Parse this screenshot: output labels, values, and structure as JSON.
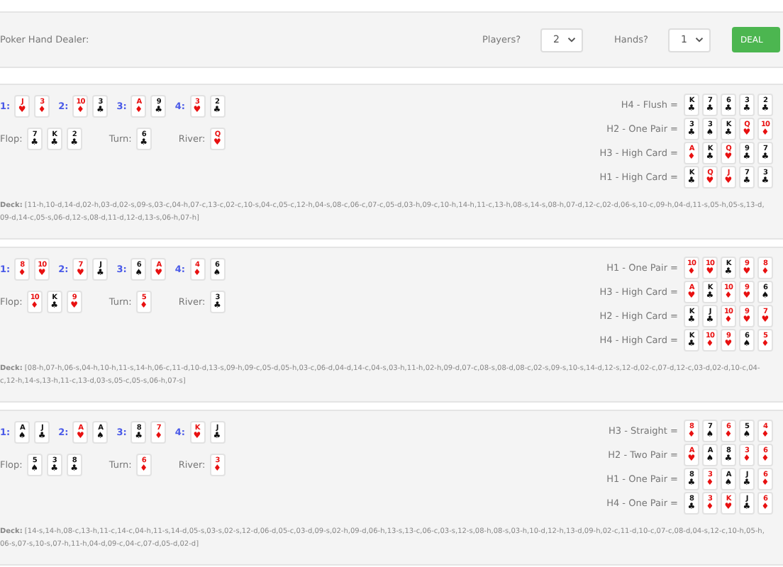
{
  "header": {
    "title": "Poker Hand Dealer:",
    "players_label": "Players?",
    "players_value": "2",
    "hands_label": "Hands?",
    "hands_value": "1",
    "deal_button": "DEAL"
  },
  "games": [
    {
      "players": [
        {
          "label": "1:",
          "cards": [
            {
              "rank": "J",
              "suit": "♥",
              "red": true
            },
            {
              "rank": "3",
              "suit": "♦",
              "red": true
            }
          ]
        },
        {
          "label": "2:",
          "cards": [
            {
              "rank": "10",
              "suit": "♦",
              "red": true
            },
            {
              "rank": "3",
              "suit": "♣",
              "red": false
            }
          ]
        },
        {
          "label": "3:",
          "cards": [
            {
              "rank": "A",
              "suit": "♦",
              "red": true
            },
            {
              "rank": "9",
              "suit": "♣",
              "red": false
            }
          ]
        },
        {
          "label": "4:",
          "cards": [
            {
              "rank": "3",
              "suit": "♥",
              "red": true
            },
            {
              "rank": "2",
              "suit": "♣",
              "red": false
            }
          ]
        }
      ],
      "flop_label": "Flop:",
      "flop": [
        {
          "rank": "7",
          "suit": "♣",
          "red": false
        },
        {
          "rank": "K",
          "suit": "♣",
          "red": false
        },
        {
          "rank": "2",
          "suit": "♣",
          "red": false
        }
      ],
      "turn_label": "Turn:",
      "turn": {
        "rank": "6",
        "suit": "♣",
        "red": false
      },
      "river_label": "River:",
      "river": {
        "rank": "Q",
        "suit": "♥",
        "red": true
      },
      "deck_text": "**Deck:** [11-h,10-d,14-d,02-h,03-d,02-s,09-s,03-c,04-h,07-c,13-c,02-c,10-s,04-c,05-c,12-h,04-s,08-c,06-c,07-c,05-d,03-h,09-c,10-h,14-h,11-c,13-h,08-s,14-s,08-h,07-d,12-c,02-d,06-s,10-c,09-h,04-d,11-s,05-h,05-s,13-d,09-d,14-c,05-s,06-d,12-s,08-d,11-d,12-d,13-s,06-h,07-h]",
      "results": [
        {
          "label": "H4 - Flush =",
          "cards": [
            {
              "rank": "K",
              "suit": "♣",
              "red": false
            },
            {
              "rank": "7",
              "suit": "♣",
              "red": false
            },
            {
              "rank": "6",
              "suit": "♣",
              "red": false
            },
            {
              "rank": "3",
              "suit": "♣",
              "red": false
            },
            {
              "rank": "2",
              "suit": "♣",
              "red": false
            }
          ]
        },
        {
          "label": "H2 - One Pair =",
          "cards": [
            {
              "rank": "3",
              "suit": "♣",
              "red": false
            },
            {
              "rank": "3",
              "suit": "♠",
              "red": false
            },
            {
              "rank": "K",
              "suit": "♣",
              "red": false
            },
            {
              "rank": "Q",
              "suit": "♥",
              "red": true
            },
            {
              "rank": "10",
              "suit": "♦",
              "red": true
            }
          ]
        },
        {
          "label": "H3 - High Card =",
          "cards": [
            {
              "rank": "A",
              "suit": "♦",
              "red": true
            },
            {
              "rank": "K",
              "suit": "♣",
              "red": false
            },
            {
              "rank": "Q",
              "suit": "♥",
              "red": true
            },
            {
              "rank": "9",
              "suit": "♣",
              "red": false
            },
            {
              "rank": "7",
              "suit": "♣",
              "red": false
            }
          ]
        },
        {
          "label": "H1 - High Card =",
          "cards": [
            {
              "rank": "K",
              "suit": "♣",
              "red": false
            },
            {
              "rank": "Q",
              "suit": "♥",
              "red": true
            },
            {
              "rank": "J",
              "suit": "♥",
              "red": true
            },
            {
              "rank": "7",
              "suit": "♣",
              "red": false
            },
            {
              "rank": "3",
              "suit": "♣",
              "red": false
            }
          ]
        }
      ]
    },
    {
      "players": [
        {
          "label": "1:",
          "cards": [
            {
              "rank": "8",
              "suit": "♦",
              "red": true
            },
            {
              "rank": "10",
              "suit": "♥",
              "red": true
            }
          ]
        },
        {
          "label": "2:",
          "cards": [
            {
              "rank": "7",
              "suit": "♥",
              "red": true
            },
            {
              "rank": "J",
              "suit": "♣",
              "red": false
            }
          ]
        },
        {
          "label": "3:",
          "cards": [
            {
              "rank": "6",
              "suit": "♠",
              "red": false
            },
            {
              "rank": "A",
              "suit": "♥",
              "red": true
            }
          ]
        },
        {
          "label": "4:",
          "cards": [
            {
              "rank": "4",
              "suit": "♦",
              "red": true
            },
            {
              "rank": "6",
              "suit": "♠",
              "red": false
            }
          ]
        }
      ],
      "flop_label": "Flop:",
      "flop": [
        {
          "rank": "10",
          "suit": "♦",
          "red": true
        },
        {
          "rank": "K",
          "suit": "♣",
          "red": false
        },
        {
          "rank": "9",
          "suit": "♥",
          "red": true
        }
      ],
      "turn_label": "Turn:",
      "turn": {
        "rank": "5",
        "suit": "♦",
        "red": true
      },
      "river_label": "River:",
      "river": {
        "rank": "3",
        "suit": "♣",
        "red": false
      },
      "deck_text": "**Deck:** [08-h,07-h,06-s,04-h,10-h,11-s,14-h,06-c,11-d,10-d,13-s,09-h,09-c,05-d,05-h,03-c,06-d,04-d,14-c,04-s,03-h,11-h,02-h,09-d,07-c,08-s,08-d,08-c,02-s,09-s,10-s,14-d,12-s,12-d,02-c,07-d,12-c,03-d,02-d,10-c,04-c,12-h,14-s,13-h,11-c,13-d,03-s,05-c,05-s,06-h,07-s]",
      "results": [
        {
          "label": "H1 - One Pair =",
          "cards": [
            {
              "rank": "10",
              "suit": "♦",
              "red": true
            },
            {
              "rank": "10",
              "suit": "♥",
              "red": true
            },
            {
              "rank": "K",
              "suit": "♣",
              "red": false
            },
            {
              "rank": "9",
              "suit": "♥",
              "red": true
            },
            {
              "rank": "8",
              "suit": "♦",
              "red": true
            }
          ]
        },
        {
          "label": "H3 - High Card =",
          "cards": [
            {
              "rank": "A",
              "suit": "♥",
              "red": true
            },
            {
              "rank": "K",
              "suit": "♣",
              "red": false
            },
            {
              "rank": "10",
              "suit": "♦",
              "red": true
            },
            {
              "rank": "9",
              "suit": "♥",
              "red": true
            },
            {
              "rank": "6",
              "suit": "♠",
              "red": false
            }
          ]
        },
        {
          "label": "H2 - High Card =",
          "cards": [
            {
              "rank": "K",
              "suit": "♣",
              "red": false
            },
            {
              "rank": "J",
              "suit": "♣",
              "red": false
            },
            {
              "rank": "10",
              "suit": "♦",
              "red": true
            },
            {
              "rank": "9",
              "suit": "♥",
              "red": true
            },
            {
              "rank": "7",
              "suit": "♥",
              "red": true
            }
          ]
        },
        {
          "label": "H4 - High Card =",
          "cards": [
            {
              "rank": "K",
              "suit": "♣",
              "red": false
            },
            {
              "rank": "10",
              "suit": "♦",
              "red": true
            },
            {
              "rank": "9",
              "suit": "♥",
              "red": true
            },
            {
              "rank": "6",
              "suit": "♠",
              "red": false
            },
            {
              "rank": "5",
              "suit": "♦",
              "red": true
            }
          ]
        }
      ]
    },
    {
      "players": [
        {
          "label": "1:",
          "cards": [
            {
              "rank": "A",
              "suit": "♠",
              "red": false
            },
            {
              "rank": "J",
              "suit": "♣",
              "red": false
            }
          ]
        },
        {
          "label": "2:",
          "cards": [
            {
              "rank": "A",
              "suit": "♥",
              "red": true
            },
            {
              "rank": "A",
              "suit": "♠",
              "red": false
            }
          ]
        },
        {
          "label": "3:",
          "cards": [
            {
              "rank": "8",
              "suit": "♣",
              "red": false
            },
            {
              "rank": "7",
              "suit": "♦",
              "red": true
            }
          ]
        },
        {
          "label": "4:",
          "cards": [
            {
              "rank": "K",
              "suit": "♥",
              "red": true
            },
            {
              "rank": "J",
              "suit": "♣",
              "red": false
            }
          ]
        }
      ],
      "flop_label": "Flop:",
      "flop": [
        {
          "rank": "5",
          "suit": "♠",
          "red": false
        },
        {
          "rank": "3",
          "suit": "♣",
          "red": false
        },
        {
          "rank": "8",
          "suit": "♣",
          "red": false
        }
      ],
      "turn_label": "Turn:",
      "turn": {
        "rank": "6",
        "suit": "♦",
        "red": true
      },
      "river_label": "River:",
      "river": {
        "rank": "3",
        "suit": "♦",
        "red": true
      },
      "deck_text": "**Deck:** [14-s,14-h,08-c,13-h,11-c,14-c,04-h,11-s,14-d,05-s,03-s,02-s,12-d,06-d,05-c,03-d,09-s,02-h,09-d,06-h,13-s,13-c,06-c,03-s,12-s,08-h,08-s,03-h,10-d,12-h,13-d,09-h,02-c,11-d,10-c,07-c,08-d,04-s,12-c,10-h,05-h,06-s,07-s,10-s,07-h,11-h,04-d,09-c,04-c,07-d,05-d,02-d]",
      "results": [
        {
          "label": "H3 - Straight =",
          "cards": [
            {
              "rank": "8",
              "suit": "♦",
              "red": true
            },
            {
              "rank": "7",
              "suit": "♠",
              "red": false
            },
            {
              "rank": "6",
              "suit": "♦",
              "red": true
            },
            {
              "rank": "5",
              "suit": "♠",
              "red": false
            },
            {
              "rank": "4",
              "suit": "♦",
              "red": true
            }
          ]
        },
        {
          "label": "H2 - Two Pair =",
          "cards": [
            {
              "rank": "A",
              "suit": "♥",
              "red": true
            },
            {
              "rank": "A",
              "suit": "♠",
              "red": false
            },
            {
              "rank": "8",
              "suit": "♣",
              "red": false
            },
            {
              "rank": "3",
              "suit": "♦",
              "red": true
            },
            {
              "rank": "6",
              "suit": "♦",
              "red": true
            }
          ]
        },
        {
          "label": "H1 - One Pair =",
          "cards": [
            {
              "rank": "8",
              "suit": "♣",
              "red": false
            },
            {
              "rank": "3",
              "suit": "♦",
              "red": true
            },
            {
              "rank": "A",
              "suit": "♠",
              "red": false
            },
            {
              "rank": "J",
              "suit": "♣",
              "red": false
            },
            {
              "rank": "6",
              "suit": "♦",
              "red": true
            }
          ]
        },
        {
          "label": "H4 - One Pair =",
          "cards": [
            {
              "rank": "8",
              "suit": "♣",
              "red": false
            },
            {
              "rank": "3",
              "suit": "♦",
              "red": true
            },
            {
              "rank": "K",
              "suit": "♥",
              "red": true
            },
            {
              "rank": "J",
              "suit": "♣",
              "red": false
            },
            {
              "rank": "6",
              "suit": "♦",
              "red": true
            }
          ]
        }
      ]
    }
  ]
}
